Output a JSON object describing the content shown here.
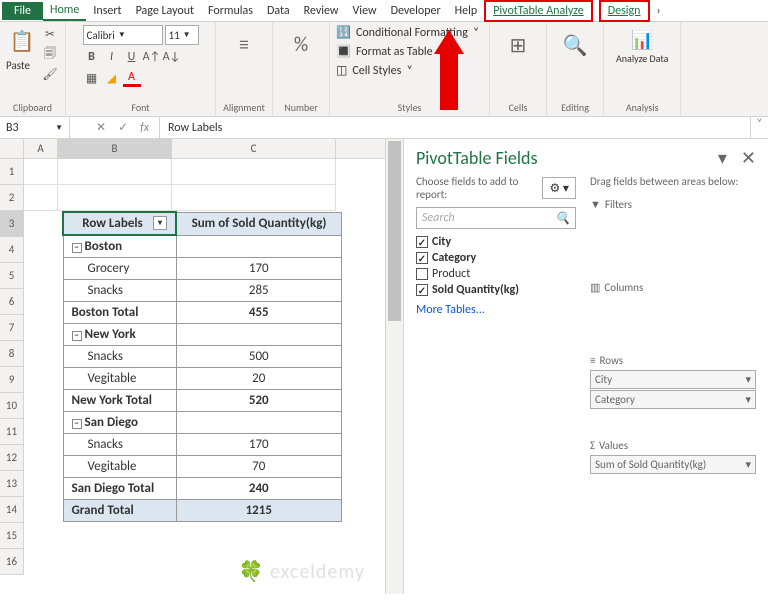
{
  "tabs": {
    "file": "File",
    "home": "Home",
    "insert": "Insert",
    "pagelayout": "Page Layout",
    "formulas": "Formulas",
    "data": "Data",
    "review": "Review",
    "view": "View",
    "developer": "Developer",
    "help": "Help",
    "ptanalyze": "PivotTable Analyze",
    "design": "Design"
  },
  "ribbon": {
    "clipboard": "Clipboard",
    "paste": "Paste",
    "font": "Font",
    "font_name": "Calibri",
    "font_size": "11",
    "alignment": "Alignment",
    "number": "Number",
    "styles": "Styles",
    "cf": "Conditional Formatting",
    "fat": "Format as Table",
    "cs": "Cell Styles",
    "cells": "Cells",
    "editing": "Editing",
    "analysis": "Analysis",
    "analyze": "Analyze Data"
  },
  "formula_bar": {
    "name_ref": "B3",
    "value": "Row Labels"
  },
  "cols": {
    "a": "A",
    "b": "B",
    "c": "C"
  },
  "row_labels": [
    "1",
    "2",
    "3",
    "4",
    "5",
    "6",
    "7",
    "8",
    "9",
    "10",
    "11",
    "12",
    "13",
    "14",
    "15",
    "16"
  ],
  "pt": {
    "h1": "Row Labels",
    "h2": "Sum of Sold Quantity(kg)",
    "g1": "Boston",
    "g1r1": "Grocery",
    "g1v1": "170",
    "g1r2": "Snacks",
    "g1v2": "285",
    "g1t": "Boston Total",
    "g1tv": "455",
    "g2": "New York",
    "g2r1": "Snacks",
    "g2v1": "500",
    "g2r2": "Vegitable",
    "g2v2": "20",
    "g2t": "New York Total",
    "g2tv": "520",
    "g3": "San Diego",
    "g3r1": "Snacks",
    "g3v1": "170",
    "g3r2": "Vegitable",
    "g3v2": "70",
    "g3t": "San Diego Total",
    "g3tv": "240",
    "gt": "Grand Total",
    "gtv": "1215"
  },
  "pane": {
    "title": "PivotTable Fields",
    "subtitle": "Choose fields to add to report:",
    "search": "Search",
    "fields": {
      "city": "City",
      "category": "Category",
      "product": "Product",
      "sold": "Sold Quantity(kg)"
    },
    "more": "More Tables...",
    "drag": "Drag fields between areas below:",
    "filters": "Filters",
    "columns": "Columns",
    "rows": "Rows",
    "values": "Values",
    "row_chip1": "City",
    "row_chip2": "Category",
    "val_chip": "Sum of Sold Quantity(kg)"
  },
  "watermark": "exceldemy"
}
